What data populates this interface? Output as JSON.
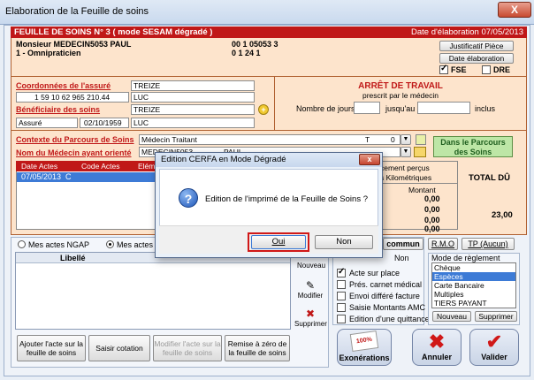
{
  "window": {
    "title": "Elaboration de la Feuille de soins",
    "close": "X"
  },
  "header": {
    "left": "FEUILLE DE SOINS  N° 3 ( mode SESAM dégradé )",
    "right": "Date d'élaboration 07/05/2013"
  },
  "doctor": {
    "name": "Monsieur MEDECIN5053 PAUL",
    "spec": "1 - Omnipraticien",
    "num1": "00 1 05053 3",
    "num2": "0 1 24 1"
  },
  "buttons_top": {
    "justif": "Justificatif Pièce",
    "date": "Date élaboration",
    "fse": "FSE",
    "dre": "DRE"
  },
  "assure": {
    "label": "Coordonnées de l'assuré",
    "nir": "1 59 10 62 965 210.44",
    "nom": "TREIZE",
    "prenom": "LUC",
    "benef_label": "Bénéficiaire des soins",
    "benef_nom": "TREIZE",
    "benef_prenom": "LUC",
    "qualite": "Assuré",
    "dob": "02/10/1959",
    "qualite_code": "0"
  },
  "arret": {
    "title": "ARRÊT DE TRAVAIL",
    "sub": "prescrit par le médecin",
    "nb_jours": "Nombre de jours",
    "jusqu": "jusqu'au",
    "inclus": "inclus"
  },
  "parcours": {
    "label": "Contexte du Parcours de Soins",
    "value": "Médecin Traitant",
    "t": "T",
    "zero": "0",
    "nom_label": "Nom du Médecin ayant orienté",
    "nom_value": "MEDECIN5053",
    "nom_value2": "PAUL",
    "box": "Dans le Parcours des Soins"
  },
  "acts_table": {
    "cols": [
      "Date Actes",
      "Code Actes",
      "Elém"
    ],
    "rows": [
      [
        "07/05/2013",
        "C",
        ""
      ]
    ],
    "right_hdr1": "cement perçus",
    "right_hdr2": "s Kilométriques",
    "montant": "Montant",
    "amounts": [
      "0,00",
      "0,00",
      "0,00",
      "0,00"
    ],
    "total_label": "TOTAL DÛ",
    "total": "23,00"
  },
  "lower": {
    "radio1": "Mes actes NGAP",
    "radio2": "Mes actes e",
    "col": "Libellé",
    "nouveau": "Nouveau",
    "modifier": "Modifier",
    "supprimer": "Supprimer",
    "btn1": "Ajouter l'acte sur la feuille de soins",
    "btn2": "Saisir cotation",
    "btn3": "Modifier l'acte sur la feuille de soins",
    "btn4": "Remise à zéro de la feuille de soins"
  },
  "options": {
    "tab_commun": "commun",
    "non": "Non",
    "acte_place": "Acte sur place",
    "pres_carnet": "Prés. carnet médical",
    "envoi": "Envoi différé facture",
    "saisie": "Saisie Montants AMC",
    "edition": "Edition d'une quittance",
    "rmo": "R.M.O",
    "tp": "TP (Aucun)",
    "mode_label": "Mode de règlement",
    "modes": [
      "Chèque",
      "Espèces",
      "Carte Bancaire",
      "Multiples",
      "TIERS PAYANT"
    ],
    "nouveau": "Nouveau",
    "supprimer": "Supprimer"
  },
  "big_buttons": {
    "exo": "Exonérations",
    "annuler": "Annuler",
    "valider": "Valider",
    "badge": "100%"
  },
  "dialog": {
    "title": "Edition CERFA en Mode Dégradé",
    "message": "Edition de l'imprimé de la Feuille de Soins ?",
    "oui": "Oui",
    "non": "Non",
    "icon": "?"
  }
}
